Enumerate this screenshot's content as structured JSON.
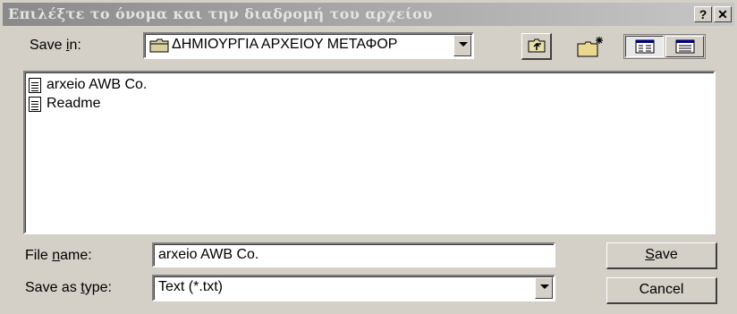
{
  "window": {
    "title": "Επιλέξτε το όνομα και την διαδρομή του αρχείου",
    "help_label": "?",
    "close_label": "✕"
  },
  "save_in": {
    "label_pre": "Save ",
    "label_accel": "i",
    "label_post": "n:",
    "value": "ΔΗΜΙΟΥΡΓΙΑ ΑΡΧΕΙΟΥ ΜΕΤΑΦΟΡ"
  },
  "toolbar": {
    "icons": [
      "up-one-level-icon",
      "create-new-folder-icon",
      "list-view-icon",
      "details-view-icon"
    ]
  },
  "files": [
    {
      "name": "arxeio AWB Co."
    },
    {
      "name": "Readme"
    }
  ],
  "file_name": {
    "label_pre": "File ",
    "label_accel": "n",
    "label_post": "ame:",
    "value": "arxeio AWB Co."
  },
  "save_as_type": {
    "label_pre": "Save as ",
    "label_accel": "t",
    "label_post": "ype:",
    "value": "Text (*.txt)"
  },
  "buttons": {
    "save_accel": "S",
    "save_rest": "ave",
    "cancel": "Cancel"
  }
}
